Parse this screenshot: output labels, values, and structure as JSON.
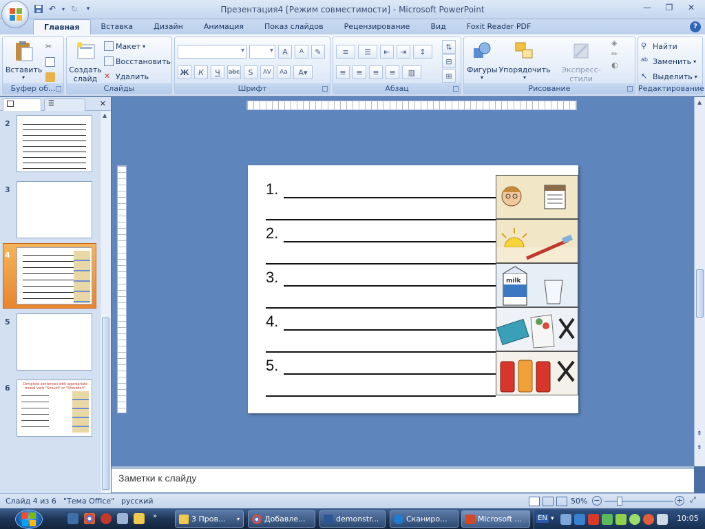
{
  "window": {
    "title": "Презентация4 [Режим совместимости] - Microsoft PowerPoint"
  },
  "tabs": [
    "Главная",
    "Вставка",
    "Дизайн",
    "Анимация",
    "Показ слайдов",
    "Рецензирование",
    "Вид",
    "Foxit Reader PDF"
  ],
  "ribbon": {
    "clipboard": {
      "label": "Буфер об...",
      "paste": "Вставить"
    },
    "slides": {
      "label": "Слайды",
      "new_slide": "Создать слайд",
      "layout": "Макет",
      "reset": "Восстановить",
      "delete": "Удалить"
    },
    "font": {
      "label": "Шрифт"
    },
    "paragraph": {
      "label": "Абзац"
    },
    "drawing": {
      "label": "Рисование",
      "shapes": "Фигуры",
      "arrange": "Упорядочить",
      "quick_styles": "Экспресс-стили"
    },
    "editing": {
      "label": "Редактирование",
      "find": "Найти",
      "replace": "Заменить",
      "select": "Выделить"
    }
  },
  "thumbnails": [
    {
      "num": "2"
    },
    {
      "num": "3"
    },
    {
      "num": "4"
    },
    {
      "num": "5"
    },
    {
      "num": "6",
      "title": "Complete sentences with appropriate modal verb \"Should\" or \"Shouldn't\""
    }
  ],
  "slide": {
    "items": [
      "1.",
      "2.",
      "3.",
      "4.",
      "5."
    ],
    "milk_label": "milk"
  },
  "notes": {
    "placeholder": "Заметки к слайду"
  },
  "status": {
    "slide": "Слайд 4 из 6",
    "theme": "\"Тема Office\"",
    "language": "русский",
    "zoom": "50%"
  },
  "taskbar": {
    "buttons": [
      "3 Пров...",
      "Добавле...",
      "demonstr...",
      "Сканиро...",
      "Microsoft ..."
    ],
    "lang": "EN",
    "clock": "10:05"
  },
  "colors": {
    "accent": "#f5a020",
    "ribbon": "#dfeaf8",
    "selected_thumb": "#e8852d"
  }
}
